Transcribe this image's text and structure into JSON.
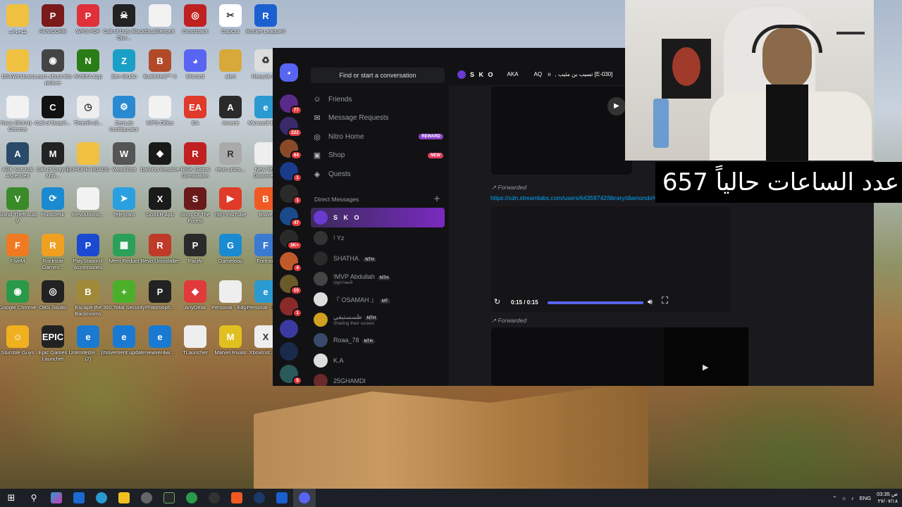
{
  "desktop": {
    "icons": [
      {
        "label": "بلوجرات",
        "color": "#f0c040",
        "glyph": ""
      },
      {
        "label": "PANICORE",
        "color": "#7a1a1a",
        "glyph": "P"
      },
      {
        "label": "WPS PDF",
        "color": "#e0303a",
        "glyph": "P"
      },
      {
        "label": "Call of Duty Black Ops...",
        "color": "#222",
        "glyph": "☠"
      },
      {
        "label": "DualSenseX",
        "color": "#f2f2f2",
        "glyph": ""
      },
      {
        "label": "CrosshairX",
        "color": "#c02020",
        "glyph": "◎"
      },
      {
        "label": "CapCut",
        "color": "#fff",
        "glyph": "✂"
      },
      {
        "label": "Rocket League®",
        "color": "#1b5fd1",
        "glyph": "R"
      },
      {
        "label": "DS4Windows",
        "color": "#f0c040",
        "glyph": ""
      },
      {
        "label": "Learn about this picture",
        "color": "#444",
        "glyph": "◉"
      },
      {
        "label": "NVIDIA App",
        "color": "#2a7d16",
        "glyph": "N"
      },
      {
        "label": "Zen Studio",
        "color": "#1aa0c8",
        "glyph": "Z"
      },
      {
        "label": "Battlefield™ 6",
        "color": "#b24a2a",
        "glyph": "B"
      },
      {
        "label": "Discord",
        "color": "#5865f2",
        "glyph": "◕"
      },
      {
        "label": "alert",
        "color": "#d6a93a",
        "glyph": ""
      },
      {
        "label": "Recycle Bin",
        "color": "#ddd",
        "glyph": "♻"
      },
      {
        "label": "Roux (RoUx) - Chrome",
        "color": "#f2f2f2",
        "glyph": ""
      },
      {
        "label": "Call of Duty®...",
        "color": "#111",
        "glyph": "C"
      },
      {
        "label": "TimerR-oil...",
        "color": "#eee",
        "glyph": "◷"
      },
      {
        "label": "ZenLab Configurator",
        "color": "#2a8ad1",
        "glyph": "⚙"
      },
      {
        "label": "WPS Office",
        "color": "#f2f2f2",
        "glyph": ""
      },
      {
        "label": "EA",
        "color": "#e03a2a",
        "glyph": "EA"
      },
      {
        "label": "Amenti",
        "color": "#2a2a2a",
        "glyph": "A"
      },
      {
        "label": "Microsoft Edge",
        "color": "#2a9ad1",
        "glyph": "e"
      },
      {
        "label": "ARK Survival Ascended",
        "color": "#2a4a6a",
        "glyph": "A"
      },
      {
        "label": "Call of Duty®: MW...",
        "color": "#222",
        "glyph": "M"
      },
      {
        "label": "EUROPE ROADS",
        "color": "#f0c040",
        "glyph": ""
      },
      {
        "label": "Wee&Test",
        "color": "#555",
        "glyph": "W"
      },
      {
        "label": "DaVinci Resolve",
        "color": "#1a1a1a",
        "glyph": "◆"
      },
      {
        "label": "RISK Global Domination",
        "color": "#c02020",
        "glyph": "R"
      },
      {
        "label": "revo-unins...",
        "color": "#aaa",
        "glyph": "R"
      },
      {
        "label": "New Text Document",
        "color": "#eee",
        "glyph": ""
      },
      {
        "label": "Grand Theft Auto V",
        "color": "#3a8a2a",
        "glyph": "V"
      },
      {
        "label": "RustDesk",
        "color": "#1a8ad1",
        "glyph": "⟳"
      },
      {
        "label": "RevoUninst...",
        "color": "#f2f2f2",
        "glyph": ""
      },
      {
        "label": "Telegram",
        "color": "#2aa0e0",
        "glyph": "➤"
      },
      {
        "label": "GoXLR App",
        "color": "#1a1a1a",
        "glyph": "X"
      },
      {
        "label": "Sons Of The Forest",
        "color": "#6a1a1a",
        "glyph": "S"
      },
      {
        "label": "(66) YouTube",
        "color": "#e03a2a",
        "glyph": "▶"
      },
      {
        "label": "Brave",
        "color": "#f05a22",
        "glyph": "B"
      },
      {
        "label": "FiveM",
        "color": "#f07a22",
        "glyph": "F"
      },
      {
        "label": "Rockstar Games...",
        "color": "#f0a020",
        "glyph": "R"
      },
      {
        "label": "PlayStation® Accessories",
        "color": "#1a4ad1",
        "glyph": "P"
      },
      {
        "label": "Mem Reduct",
        "color": "#2aa05a",
        "glyph": "▦"
      },
      {
        "label": "Revo Uninstaller",
        "color": "#c03a2a",
        "glyph": "R"
      },
      {
        "label": "Pacify",
        "color": "#2a2a2a",
        "glyph": "P"
      },
      {
        "label": "Gameloop",
        "color": "#1a8ad1",
        "glyph": "G"
      },
      {
        "label": "Fortnite",
        "color": "#3a7ad1",
        "glyph": "F"
      },
      {
        "label": "Google Chrome",
        "color": "#2a9a4a",
        "glyph": "◉"
      },
      {
        "label": "OBS Studio",
        "color": "#222",
        "glyph": "◎"
      },
      {
        "label": "Escape the Backrooms",
        "color": "#a08a3a",
        "glyph": "B"
      },
      {
        "label": "360 Total Security",
        "color": "#4ab02a",
        "glyph": "+"
      },
      {
        "label": "Phasmoph...",
        "color": "#222",
        "glyph": "P"
      },
      {
        "label": "AnyDesk",
        "color": "#e03a3a",
        "glyph": "◆"
      },
      {
        "label": "Personal - Edge",
        "color": "#eee",
        "glyph": ""
      },
      {
        "label": "Personal - Edge",
        "color": "#2a9ad1",
        "glyph": "e"
      },
      {
        "label": "Stumble Guys",
        "color": "#f0b020",
        "glyph": "☺"
      },
      {
        "label": "Epic Games Launcher",
        "color": "#222",
        "glyph": "EPIC"
      },
      {
        "label": "Unlimited/e... (1) (2)",
        "color": "#1a7ad1",
        "glyph": "e"
      },
      {
        "label": "movement update",
        "color": "#1a7ad1",
        "glyph": "e"
      },
      {
        "label": "newver4wi...",
        "color": "#1a7ad1",
        "glyph": "e"
      },
      {
        "label": "TLauncher",
        "color": "#eee",
        "glyph": ""
      },
      {
        "label": "Marvel Rivals",
        "color": "#e0c020",
        "glyph": "M"
      },
      {
        "label": "XboxInst... (1)",
        "color": "#eee",
        "glyph": "X"
      }
    ]
  },
  "discord": {
    "search_placeholder": "Find or start a conversation",
    "nav": [
      {
        "label": "Friends",
        "icon": "☺"
      },
      {
        "label": "Message Requests",
        "icon": "✉"
      },
      {
        "label": "Nitro Home",
        "icon": "◎",
        "pill": "REWARD",
        "pill_color": "#8a44c8"
      },
      {
        "label": "Shop",
        "icon": "▣",
        "pill": "NEW",
        "pill_color": "#e03a5a"
      },
      {
        "label": "Quests",
        "icon": "◈"
      }
    ],
    "dm_header": "Direct Messages",
    "dms": [
      {
        "name": "S K O",
        "sub": "",
        "tag": "",
        "color": "#6a3ad1"
      },
      {
        "name": "! Yz",
        "sub": "",
        "tag": "",
        "color": "#333"
      },
      {
        "name": "SHATHA.",
        "sub": "",
        "tag": "NTH",
        "color": "#2a2a2a"
      },
      {
        "name": "!MVP Abdullah",
        "sub": "грустный",
        "tag": "NTH",
        "color": "#444"
      },
      {
        "name": "『 OSAMAH 』",
        "sub": "",
        "tag": "MT",
        "color": "#ddd"
      },
      {
        "name": "ظسستيفي",
        "sub": "Sharing their screen",
        "tag": "NTH",
        "color": "#d1a020"
      },
      {
        "name": "Roaa_78",
        "sub": "",
        "tag": "NTH",
        "color": "#3a4a6a"
      },
      {
        "name": "K.A",
        "sub": "",
        "tag": "",
        "color": "#ddd"
      },
      {
        "name": "25GHAMDI",
        "sub": "",
        "tag": "",
        "color": "#6a2a2a"
      }
    ],
    "guild_badges": [
      "77",
      "222",
      "64",
      "1",
      "1",
      "47",
      "3K+",
      "4",
      "10",
      "1",
      "",
      "",
      "5"
    ],
    "header_name": "S K O",
    "header_items": [
      "AKA",
      "AQ",
      "ıı",
      "[E-030] تسيب بن مثيب ,"
    ],
    "forwarded_label": "Forwarded",
    "link": "https://cdn.streamlabs.com/users/64359742/library/diamonds%20amv%20(1).webm",
    "video_time": "0:15 / 0:15",
    "video_progress": 1.0
  },
  "overlay": {
    "text": "عدد الساعات حالياً 657"
  },
  "tray": {
    "lang": "ENG",
    "time": "03:35 ص",
    "date": "٢٧/٠٧/١٨"
  },
  "colors": {
    "discord_blurple": "#5865f2",
    "link": "#00a8fc",
    "taskbar": "#1c1f26"
  }
}
